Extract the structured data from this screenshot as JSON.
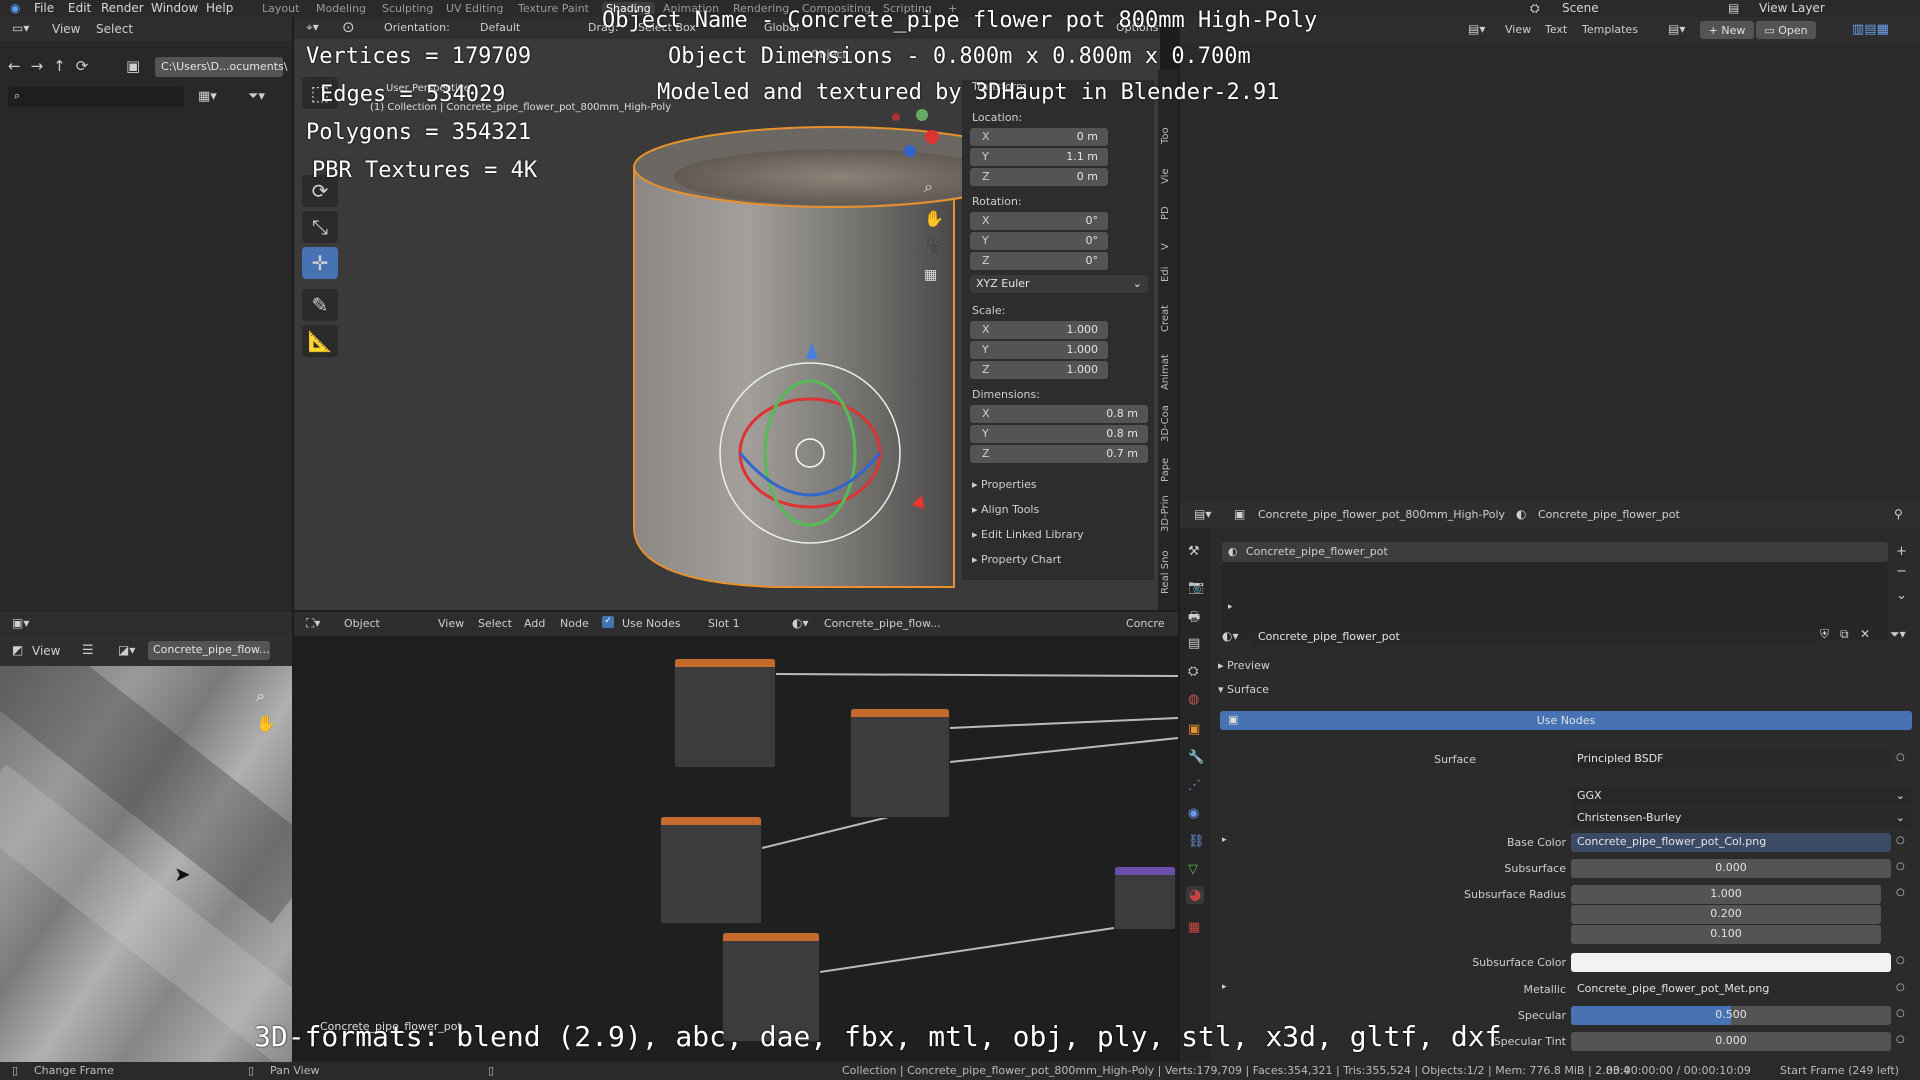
{
  "menubar": {
    "items": [
      "File",
      "Edit",
      "Render",
      "Window",
      "Help"
    ],
    "workspaces": [
      "Layout",
      "Modeling",
      "Sculpting",
      "UV Editing",
      "Texture Paint",
      "Shading",
      "Animation",
      "Rendering",
      "Compositing",
      "Scripting"
    ],
    "active_workspace": "Shading",
    "scene": "Scene",
    "view_layer": "View Layer"
  },
  "file_browser": {
    "menu": [
      "View",
      "Select"
    ],
    "path": "C:\\Users\\D...ocuments\\"
  },
  "viewport_header": {
    "orientation_label": "Orientation:",
    "orientation_value": "Default",
    "drag_label": "Drag:",
    "drag_value": "Select Box",
    "transform_value": "Global",
    "options": "Options",
    "mode": "Object",
    "view_name": "User Perspective",
    "collection": "(1) Collection | Concrete_pipe_flower_pot_800mm_High-Poly"
  },
  "text_editor_header": {
    "items": [
      "View",
      "Text",
      "Templates"
    ],
    "new": "New",
    "open": "Open"
  },
  "overlay": {
    "object_name": "Object Name - Concrete_pipe flower pot 800mm High-Poly",
    "dimensions": "Object Dimensions - 0.800m x 0.800m x 0.700m",
    "modeled": "Modeled and textured by 3DHaupt in Blender-2.91",
    "vertices": "Vertices = 179709",
    "edges": "Edges = 534029",
    "polygons": "Polygons = 354321",
    "pbr": "PBR Textures = 4K",
    "formats": "3D-formats: blend (2.9), abc, dae, fbx, mtl, obj, ply, stl, x3d, gltf, dxf"
  },
  "transform": {
    "header": "Transform",
    "location_label": "Location:",
    "location": [
      {
        "axis": "X",
        "value": "0 m"
      },
      {
        "axis": "Y",
        "value": "1.1 m"
      },
      {
        "axis": "Z",
        "value": "0 m"
      }
    ],
    "rotation_label": "Rotation:",
    "rotation": [
      {
        "axis": "X",
        "value": "0°"
      },
      {
        "axis": "Y",
        "value": "0°"
      },
      {
        "axis": "Z",
        "value": "0°"
      }
    ],
    "rotation_mode": "XYZ Euler",
    "scale_label": "Scale:",
    "scale": [
      {
        "axis": "X",
        "value": "1.000"
      },
      {
        "axis": "Y",
        "value": "1.000"
      },
      {
        "axis": "Z",
        "value": "1.000"
      }
    ],
    "dimensions_label": "Dimensions:",
    "dimensions": [
      {
        "axis": "X",
        "value": "0.8 m"
      },
      {
        "axis": "Y",
        "value": "0.8 m"
      },
      {
        "axis": "Z",
        "value": "0.7 m"
      }
    ],
    "panels": [
      "Properties",
      "Align Tools",
      "Edit Linked Library",
      "Property Chart"
    ],
    "side_tabs": [
      "Too",
      "Vie",
      "PD",
      "V",
      "Edi",
      "Creat",
      "Animat",
      "3D-Coa",
      "Pape",
      "3D-Prin",
      "Real Sno"
    ]
  },
  "node_editor": {
    "mode": "Object",
    "menu": [
      "View",
      "Select",
      "Add",
      "Node"
    ],
    "use_nodes": "Use Nodes",
    "slot": "Slot 1",
    "material": "Concrete_pipe_flow...",
    "material_right": "Concre"
  },
  "image_editor": {
    "view": "View",
    "image": "Concrete_pipe_flow...",
    "object_label": "Concrete_pipe_flower_pot"
  },
  "properties": {
    "object": "Concrete_pipe_flower_pot_800mm_High-Poly",
    "material": "Concrete_pipe_flower_pot",
    "slot_item": "Concrete_pipe_flower_pot",
    "material_field": "Concrete_pipe_flower_pot",
    "sections": {
      "preview": "Preview",
      "surface": "Surface"
    },
    "use_nodes": "Use Nodes",
    "surface_label": "Surface",
    "surface_value": "Principled BSDF",
    "distribution": "GGX",
    "subsurface_method": "Christensen-Burley",
    "rows": [
      {
        "label": "Base Color",
        "value": "Concrete_pipe_flower_pot_Col.png"
      },
      {
        "label": "Subsurface",
        "value": "0.000"
      },
      {
        "label": "Subsurface Radius",
        "values": [
          "1.000",
          "0.200",
          "0.100"
        ]
      },
      {
        "label": "Subsurface Color",
        "value": ""
      },
      {
        "label": "Metallic",
        "value": "Concrete_pipe_flower_pot_Met.png"
      },
      {
        "label": "Specular",
        "value": "0.500"
      },
      {
        "label": "Specular Tint",
        "value": "0.000"
      }
    ],
    "specular_fill": 0.5
  },
  "statusbar": {
    "left1": "Change Frame",
    "left2": "Pan View",
    "stats": "Collection | Concrete_pipe_flower_pot_800mm_High-Poly | Verts:179,709 | Faces:354,321 | Tris:355,524 | Objects:1/2 | Mem: 776.8 MiB | 2.83.4",
    "time": "00:00:00:00 / 00:00:10:09",
    "frame": "Start Frame (249 left)"
  },
  "colors": {
    "accent": "#4772b3",
    "selected_outline": "#e8912d",
    "header_orange": "#c56a2d"
  }
}
